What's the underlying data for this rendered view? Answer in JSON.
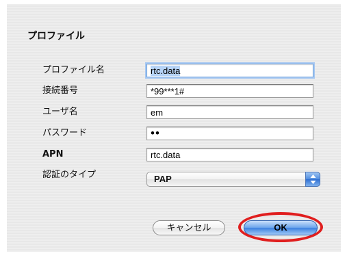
{
  "section_title": "プロファイル",
  "fields": [
    {
      "label": "プロファイル名",
      "value": "rtc.data"
    },
    {
      "label": "接続番号",
      "value": "*99***1#"
    },
    {
      "label": "ユーザ名",
      "value": "em"
    },
    {
      "label": "パスワード",
      "value": "••"
    },
    {
      "label": "APN",
      "value": "rtc.data"
    },
    {
      "label": "認証のタイプ",
      "value": "PAP"
    }
  ],
  "buttons": {
    "cancel": "キャンセル",
    "ok": "OK"
  },
  "colors": {
    "highlight": "#e01e1e",
    "accent": "#3d82e0"
  }
}
